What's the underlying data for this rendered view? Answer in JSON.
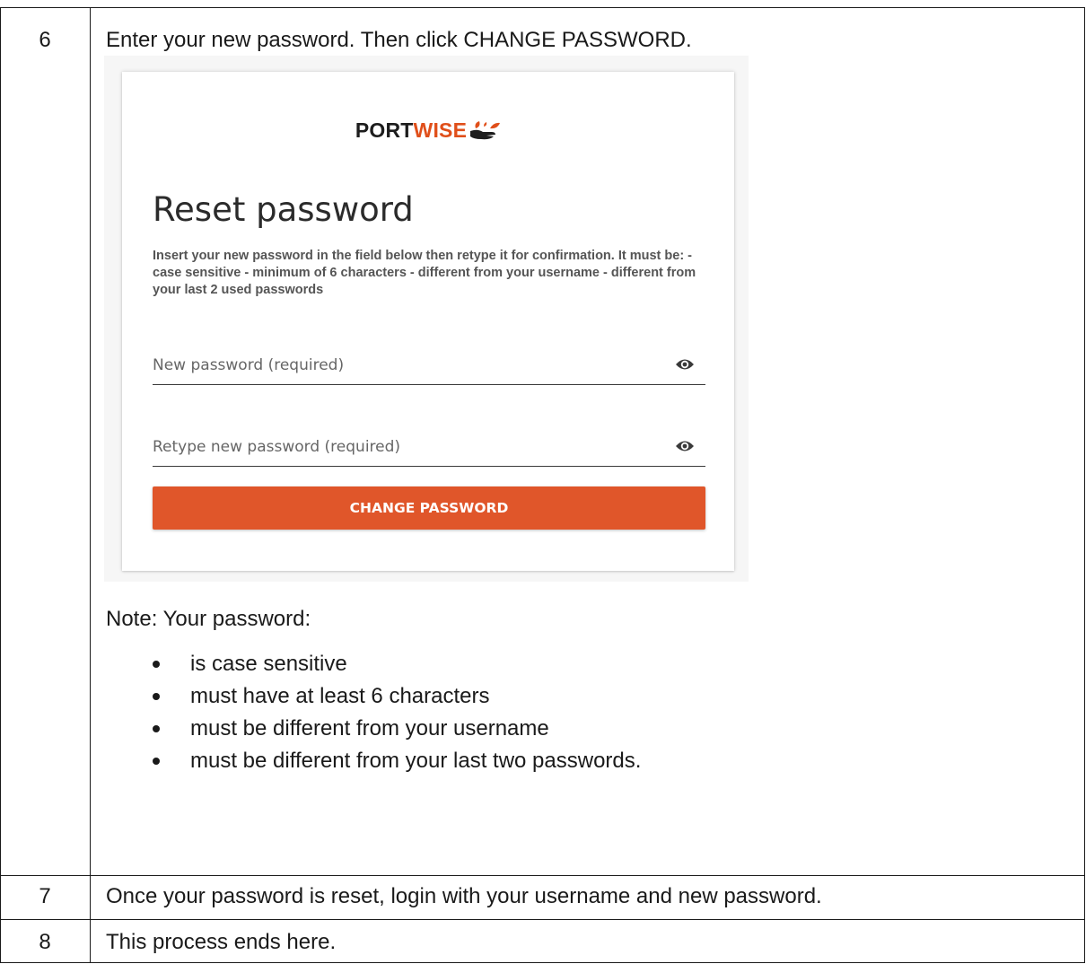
{
  "steps": [
    {
      "number": "6",
      "instruction": "Enter your new password. Then click CHANGE PASSWORD.",
      "screenshot": {
        "logo": {
          "part1": "PORT",
          "part2": "WISE"
        },
        "title": "Reset password",
        "description": "Insert your new password in the field below then retype it for confirmation. It must be: - case sensitive - minimum of 6 characters - different from your username - different from your last 2 used passwords",
        "new_password_placeholder": "New password (required)",
        "retype_password_placeholder": "Retype new password (required)",
        "button_label": "CHANGE PASSWORD",
        "icons": [
          "eye-icon",
          "eye-icon"
        ],
        "colors": {
          "accent": "#e0562a",
          "logo_wise": "#e04f1a"
        }
      },
      "note_heading": "Note: Your password:",
      "note_items": [
        "is case sensitive",
        "must have at least 6 characters",
        "must be different from your username",
        "must be different from your last two passwords."
      ]
    },
    {
      "number": "7",
      "instruction": "Once your password is reset, login with your username and new password."
    },
    {
      "number": "8",
      "instruction": "This process ends here."
    }
  ]
}
